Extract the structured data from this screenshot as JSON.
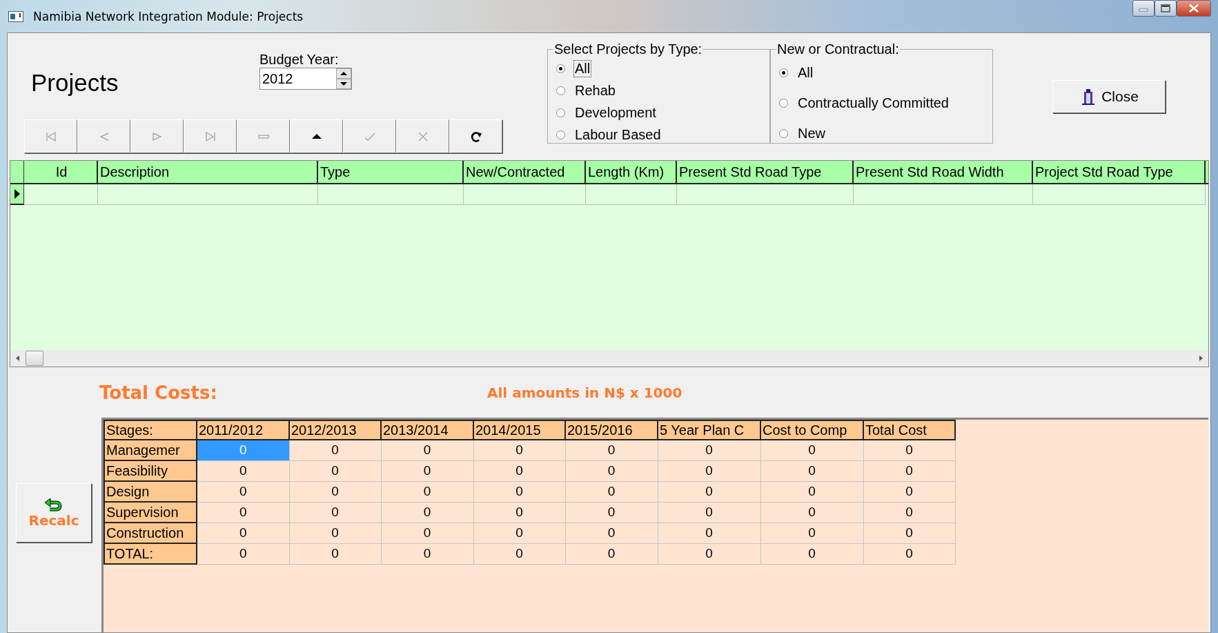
{
  "window": {
    "title": "Namibia Network Integration Module: Projects"
  },
  "heading": "Projects",
  "budget_year": {
    "label": "Budget Year:",
    "value": "2012"
  },
  "navigator": [
    {
      "kind": "first",
      "disabled": true
    },
    {
      "kind": "prior",
      "disabled": true
    },
    {
      "kind": "next",
      "disabled": true
    },
    {
      "kind": "last",
      "disabled": true
    },
    {
      "kind": "delete",
      "disabled": true
    },
    {
      "kind": "edit",
      "disabled": false
    },
    {
      "kind": "post",
      "disabled": true
    },
    {
      "kind": "cancel",
      "disabled": true
    },
    {
      "kind": "refresh",
      "disabled": false
    }
  ],
  "type_filter": {
    "title": "Select Projects by Type:",
    "options": [
      {
        "label": "All",
        "selected": true,
        "focused": true
      },
      {
        "label": "Rehab",
        "selected": false,
        "focused": false
      },
      {
        "label": "Development",
        "selected": false,
        "focused": false
      },
      {
        "label": "Labour Based",
        "selected": false,
        "focused": false
      }
    ]
  },
  "contract_filter": {
    "title": "New or Contractual:",
    "options": [
      {
        "label": "All",
        "selected": true
      },
      {
        "label": "Contractually Committed",
        "selected": false
      },
      {
        "label": "New",
        "selected": false
      }
    ]
  },
  "close_button": {
    "label": "Close"
  },
  "grid": {
    "columns": [
      "Id",
      "Description",
      "Type",
      "New/Contracted",
      "Length (Km)",
      "Present Std Road Type",
      "Present Std Road Width",
      "Project Std Road Type"
    ],
    "rows": [
      {
        "current": true
      }
    ]
  },
  "totals": {
    "title": "Total Costs:",
    "note": "All amounts in N$ x 1000"
  },
  "recalc_button": {
    "label": "Recalc"
  },
  "cost_table": {
    "columns": [
      "Stages:",
      "2011/2012",
      "2012/2013",
      "2013/2014",
      "2014/2015",
      "2015/2016",
      "5 Year Plan C",
      "Cost to Comp",
      "Total Cost"
    ],
    "rows": [
      {
        "stage": "Managemer",
        "values": [
          {
            "text": "0",
            "selected": true
          },
          {
            "text": "0",
            "selected": false
          },
          {
            "text": "0",
            "selected": false
          },
          {
            "text": "0",
            "selected": false
          },
          {
            "text": "0",
            "selected": false
          },
          {
            "text": "0",
            "selected": false
          },
          {
            "text": "0",
            "selected": false
          },
          {
            "text": "0",
            "selected": false
          }
        ]
      },
      {
        "stage": "Feasibility",
        "values": [
          {
            "text": "0",
            "selected": false
          },
          {
            "text": "0",
            "selected": false
          },
          {
            "text": "0",
            "selected": false
          },
          {
            "text": "0",
            "selected": false
          },
          {
            "text": "0",
            "selected": false
          },
          {
            "text": "0",
            "selected": false
          },
          {
            "text": "0",
            "selected": false
          },
          {
            "text": "0",
            "selected": false
          }
        ]
      },
      {
        "stage": "Design",
        "values": [
          {
            "text": "0",
            "selected": false
          },
          {
            "text": "0",
            "selected": false
          },
          {
            "text": "0",
            "selected": false
          },
          {
            "text": "0",
            "selected": false
          },
          {
            "text": "0",
            "selected": false
          },
          {
            "text": "0",
            "selected": false
          },
          {
            "text": "0",
            "selected": false
          },
          {
            "text": "0",
            "selected": false
          }
        ]
      },
      {
        "stage": "Supervision",
        "values": [
          {
            "text": "0",
            "selected": false
          },
          {
            "text": "0",
            "selected": false
          },
          {
            "text": "0",
            "selected": false
          },
          {
            "text": "0",
            "selected": false
          },
          {
            "text": "0",
            "selected": false
          },
          {
            "text": "0",
            "selected": false
          },
          {
            "text": "0",
            "selected": false
          },
          {
            "text": "0",
            "selected": false
          }
        ]
      },
      {
        "stage": "Construction",
        "values": [
          {
            "text": "0",
            "selected": false
          },
          {
            "text": "0",
            "selected": false
          },
          {
            "text": "0",
            "selected": false
          },
          {
            "text": "0",
            "selected": false
          },
          {
            "text": "0",
            "selected": false
          },
          {
            "text": "0",
            "selected": false
          },
          {
            "text": "0",
            "selected": false
          },
          {
            "text": "0",
            "selected": false
          }
        ]
      },
      {
        "stage": "TOTAL:",
        "values": [
          {
            "text": "0",
            "selected": false
          },
          {
            "text": "0",
            "selected": false
          },
          {
            "text": "0",
            "selected": false
          },
          {
            "text": "0",
            "selected": false
          },
          {
            "text": "0",
            "selected": false
          },
          {
            "text": "0",
            "selected": false
          },
          {
            "text": "0",
            "selected": false
          },
          {
            "text": "0",
            "selected": false
          }
        ]
      }
    ]
  }
}
